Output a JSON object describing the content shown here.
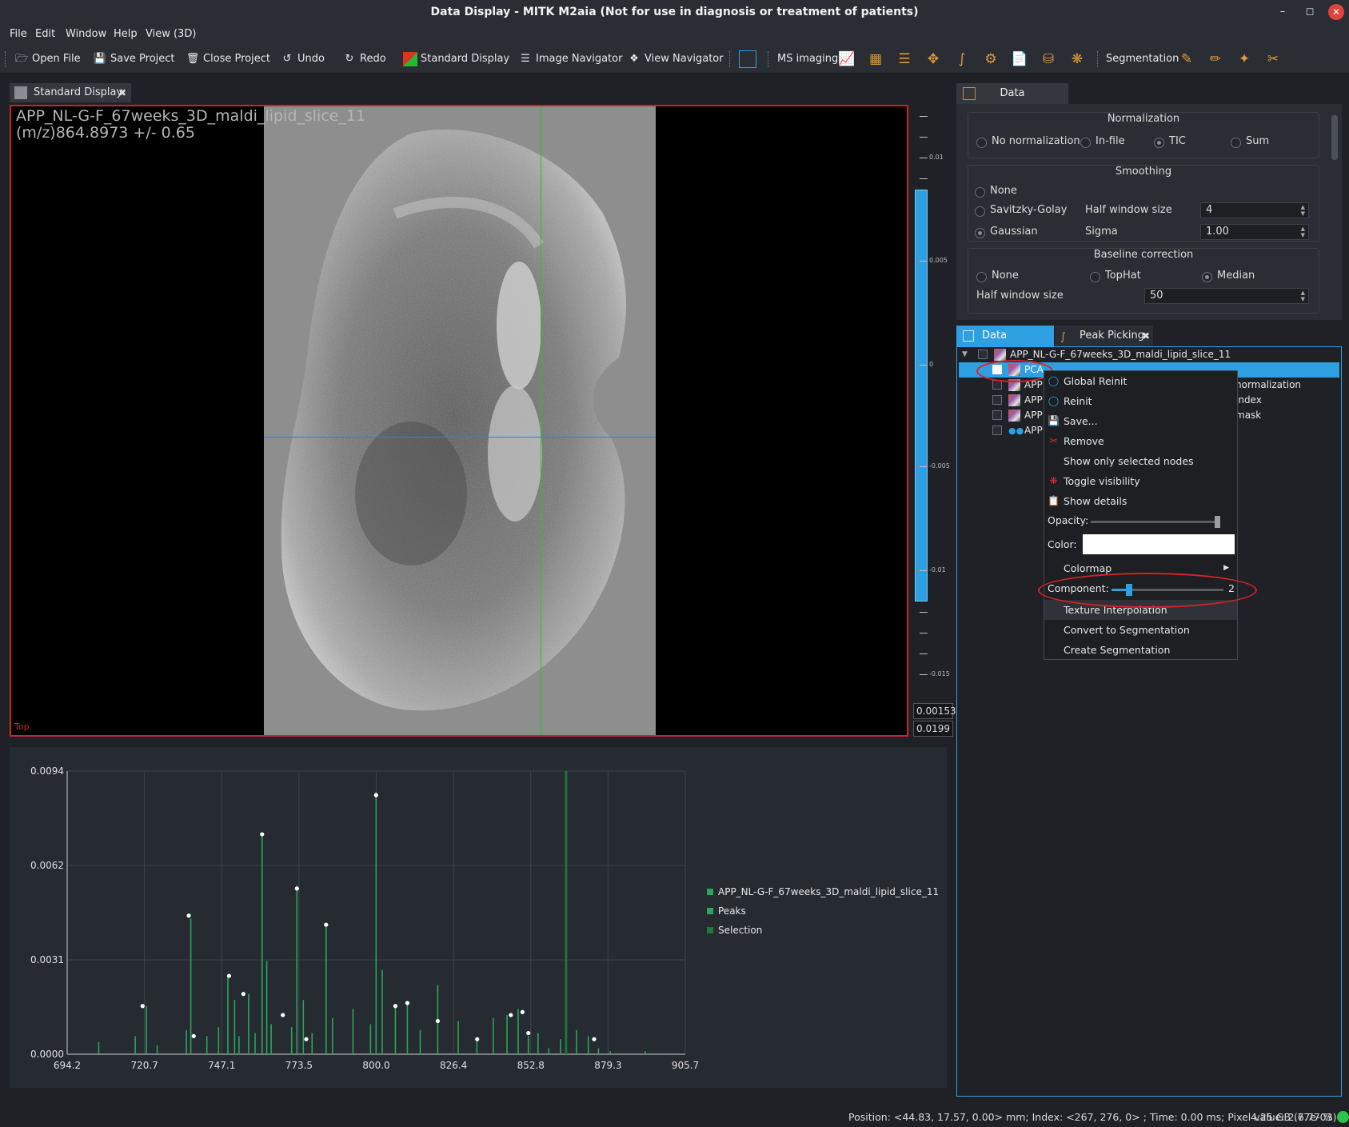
{
  "window": {
    "title": "Data Display - MITK M2aia (Not for use in diagnosis or treatment of patients)"
  },
  "menu": [
    "File",
    "Edit",
    "Window",
    "Help",
    "View (3D)"
  ],
  "toolbar": {
    "open_file": "Open File",
    "save_project": "Save Project",
    "close_project": "Close Project",
    "undo": "Undo",
    "redo": "Redo",
    "standard_display": "Standard Display",
    "image_navigator": "Image Navigator",
    "view_navigator": "View Navigator",
    "ms_imaging": "MS imaging",
    "segmentation": "Segmentation"
  },
  "display": {
    "tab": "Standard Display",
    "title_line1": "APP_NL-G-F_67weeks_3D_maldi_lipid_slice_11",
    "title_line2": "(m/z)864.8973 +/- 0.65",
    "corner": "Top",
    "level_labels": [
      "0.01",
      "0.005",
      "0",
      "-0.005",
      "-0.01",
      "-0.015"
    ],
    "level_value": "0.00153",
    "window_value": "0.0199"
  },
  "chart_data": {
    "type": "line",
    "xlabel": "",
    "ylabel": "",
    "xlim": [
      694.2,
      905.7
    ],
    "ylim": [
      0,
      0.0094
    ],
    "x_ticks": [
      "694.2",
      "720.7",
      "747.1",
      "773.5",
      "800.0",
      "826.4",
      "852.8",
      "879.3",
      "905.7"
    ],
    "y_ticks": [
      "0.0000",
      "0.0031",
      "0.0062",
      "0.0094"
    ],
    "series": [
      {
        "name": "APP_NL-G-F_67weeks_3D_maldi_lipid_slice_11",
        "color": "#2aa65a",
        "x": [
          705.0,
          717.5,
          721.3,
          725.0,
          735.0,
          736.5,
          742.0,
          746.0,
          749.2,
          751.5,
          753.0,
          756.3,
          758.5,
          760.9,
          762.5,
          764.0,
          771.0,
          772.8,
          775.0,
          778.0,
          782.8,
          785.0,
          792.0,
          798.0,
          799.9,
          802.0,
          806.5,
          810.6,
          815.0,
          821.0,
          828.0,
          834.4,
          840.0,
          844.7,
          848.5,
          852.0,
          855.3,
          859.0,
          863.0,
          868.5,
          872.5,
          876.0,
          880.0,
          892.0
        ],
        "y": [
          0.0004,
          0.0006,
          0.0016,
          0.0003,
          0.0008,
          0.0045,
          0.0006,
          0.0009,
          0.0026,
          0.0018,
          0.0006,
          0.002,
          0.0007,
          0.0073,
          0.0031,
          0.001,
          0.0009,
          0.0056,
          0.0018,
          0.0007,
          0.0043,
          0.0012,
          0.0015,
          0.001,
          0.0087,
          0.0028,
          0.0016,
          0.0017,
          0.0008,
          0.0023,
          0.0011,
          0.0005,
          0.0012,
          0.0013,
          0.0015,
          0.0006,
          0.0007,
          0.0002,
          0.0005,
          0.0008,
          0.0006,
          0.0002,
          0.0001,
          0.0001
        ]
      },
      {
        "name": "Peaks",
        "color": "#2aa65a",
        "x": [
          720.0,
          735.8,
          749.6,
          760.9,
          772.8,
          782.8,
          799.9,
          806.5,
          810.6,
          821.0,
          846.0,
          850.0,
          852.0,
          874.5,
          737.5,
          754.5,
          768.0,
          776.0,
          834.5
        ],
        "y": [
          0.0016,
          0.0046,
          0.0026,
          0.0073,
          0.0055,
          0.0043,
          0.0086,
          0.0016,
          0.0017,
          0.0011,
          0.0013,
          0.0014,
          0.0007,
          0.0005,
          0.0006,
          0.002,
          0.0013,
          0.0005,
          0.0005
        ]
      },
      {
        "name": "Selection",
        "color": "#1f7a3c",
        "x": [
          864.9
        ],
        "y": [
          0.0094
        ]
      }
    ]
  },
  "data_panel": {
    "tab": "Data",
    "normalization": {
      "title": "Normalization",
      "options": [
        "No normalization",
        "In-file",
        "TIC",
        "Sum"
      ],
      "selected": "TIC"
    },
    "smoothing": {
      "title": "Smoothing",
      "options": [
        "None",
        "Savitzky-Golay",
        "Gaussian"
      ],
      "selected": "Gaussian",
      "half_window_label": "Half window size",
      "half_window_value": "4",
      "sigma_label": "Sigma",
      "sigma_value": "1.00"
    },
    "baseline": {
      "title": "Baseline correction",
      "options": [
        "None",
        "TopHat",
        "Median"
      ],
      "selected": "Median",
      "half_window_label": "Half window size",
      "half_window_value": "50"
    }
  },
  "data_manager": {
    "tabs": [
      "Data Manager",
      "Peak Picking"
    ],
    "root": "APP_NL-G-F_67weeks_3D_maldi_lipid_slice_11",
    "rows": [
      {
        "label": "PCA",
        "suffix": ""
      },
      {
        "label": "APP",
        "suffix": "normalization"
      },
      {
        "label": "APP",
        "suffix": "index"
      },
      {
        "label": "APP",
        "suffix": "mask"
      },
      {
        "label": "APP",
        "suffix": ""
      }
    ]
  },
  "context_menu": {
    "global_reinit": "Global Reinit",
    "reinit": "Reinit",
    "save": "Save...",
    "remove": "Remove",
    "show_only": "Show only selected nodes",
    "toggle_visibility": "Toggle visibility",
    "show_details": "Show details",
    "opacity": "Opacity:",
    "color": "Color:",
    "colormap": "Colormap",
    "component": "Component:",
    "component_value": "2",
    "texture_interpolation": "Texture Interpolation",
    "convert_to_segmentation": "Convert to Segmentation",
    "create_segmentation": "Create Segmentation"
  },
  "status_bar": {
    "text": "Position: <44.83, 17.57, 0.00> mm; Index: <267, 276, 0> ; Time: 0.00 ms; Pixel value: 2.77e-03",
    "memory": "4.25 GB (6.77 %)"
  }
}
